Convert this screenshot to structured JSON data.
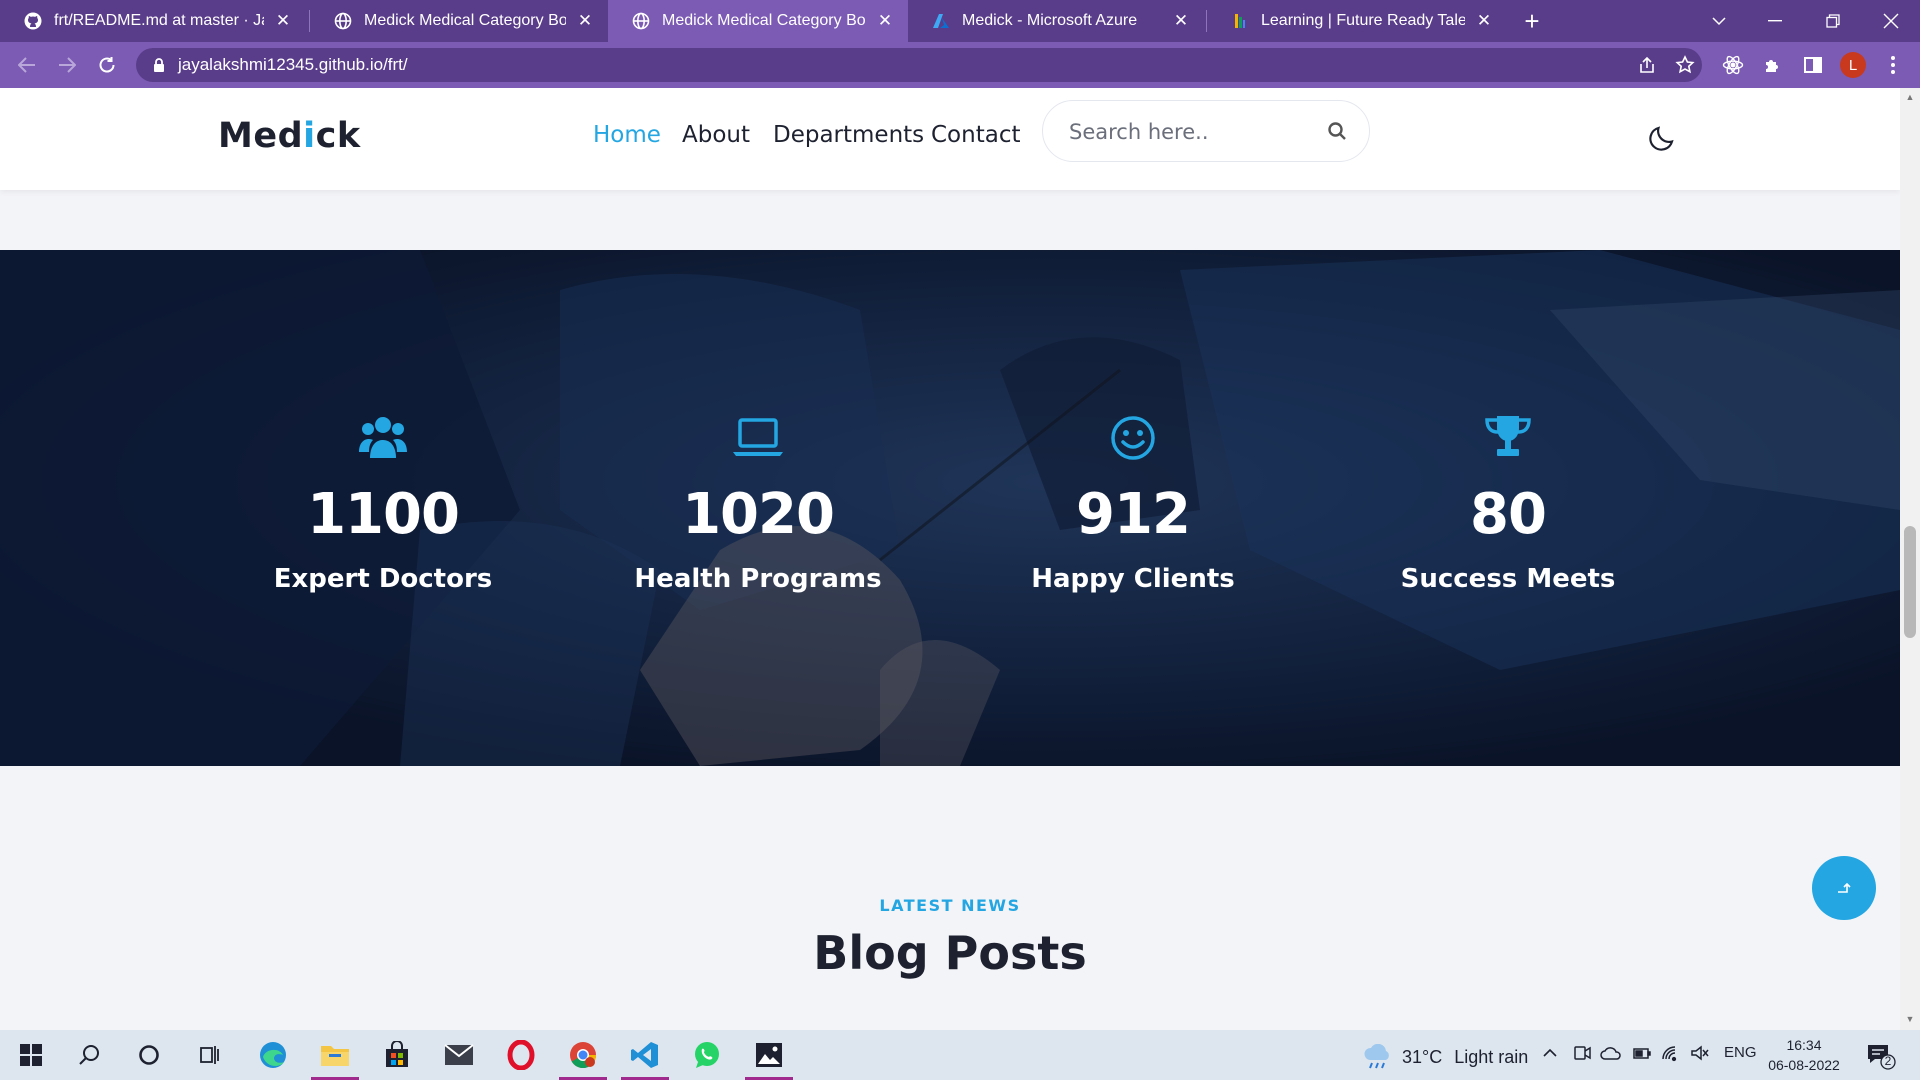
{
  "browser": {
    "tabs": [
      {
        "title": "frt/README.md at master · Jayala",
        "favicon": "github-icon",
        "active": false
      },
      {
        "title": "Medick Medical Category Bootstr",
        "favicon": "globe-icon",
        "active": false
      },
      {
        "title": "Medick Medical Category Bootstr",
        "favicon": "globe-icon",
        "active": true
      },
      {
        "title": "Medick - Microsoft Azure",
        "favicon": "azure-icon",
        "active": false
      },
      {
        "title": "Learning | Future Ready Talent",
        "favicon": "frt-icon",
        "active": false
      }
    ],
    "url": "jayalakshmi12345.github.io/frt/",
    "profile_initial": "L",
    "theme_color": "#5a3d8a"
  },
  "site": {
    "logo_prefix": "Med",
    "logo_accent": "i",
    "logo_suffix": "ck",
    "nav": [
      "Home",
      "About",
      "Departments",
      "Contact"
    ],
    "nav_active": "Home",
    "search_placeholder": "Search here..",
    "accent_color": "#23a6e2"
  },
  "stats": [
    {
      "icon": "users-icon",
      "value": "1100",
      "label": "Expert Doctors"
    },
    {
      "icon": "laptop-icon",
      "value": "1020",
      "label": "Health Programs"
    },
    {
      "icon": "smile-icon",
      "value": "912",
      "label": "Happy Clients"
    },
    {
      "icon": "trophy-icon",
      "value": "80",
      "label": "Success Meets"
    }
  ],
  "blog": {
    "kicker": "LATEST NEWS",
    "title": "Blog Posts"
  },
  "taskbar": {
    "weather_temp": "31°C",
    "weather_desc": "Light rain",
    "language": "ENG",
    "time": "16:34",
    "date": "06-08-2022",
    "notifications": "2"
  }
}
